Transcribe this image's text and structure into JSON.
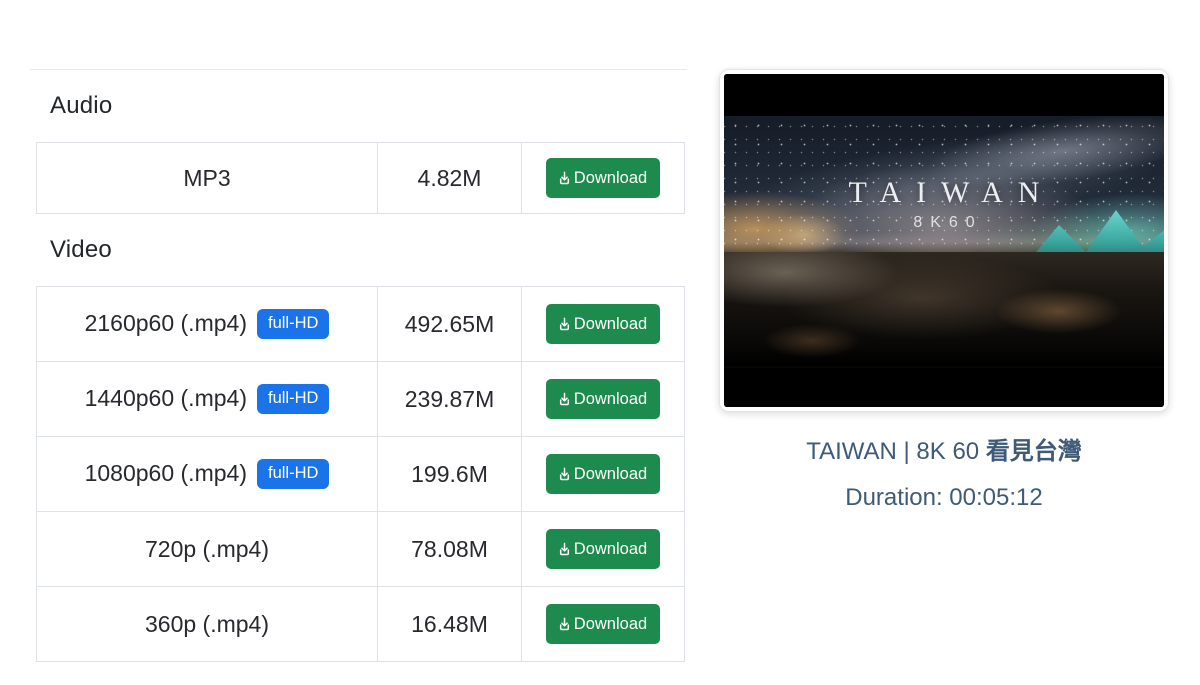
{
  "colors": {
    "download_button_green": "#1e8b4e",
    "badge_blue": "#1a73e8",
    "info_text_blue": "#3e5a78",
    "table_border": "#dee2e6"
  },
  "sections": {
    "audio": {
      "heading": "Audio",
      "rows": [
        {
          "format": "MP3",
          "size": "4.82M",
          "download_label": "Download"
        }
      ]
    },
    "video": {
      "heading": "Video",
      "rows": [
        {
          "format": "2160p60 (.mp4)",
          "badge": "full-HD",
          "size": "492.65M",
          "download_label": "Download"
        },
        {
          "format": "1440p60 (.mp4)",
          "badge": "full-HD",
          "size": "239.87M",
          "download_label": "Download"
        },
        {
          "format": "1080p60 (.mp4)",
          "badge": "full-HD",
          "size": "199.6M",
          "download_label": "Download"
        },
        {
          "format": "720p (.mp4)",
          "size": "78.08M",
          "download_label": "Download"
        },
        {
          "format": "360p (.mp4)",
          "size": "16.48M",
          "download_label": "Download"
        }
      ]
    }
  },
  "video_info": {
    "thumbnail_overlay": {
      "title": "TAIWAN",
      "subtitle": "8K60"
    },
    "title_latin": "TAIWAN | 8K 60 ",
    "title_cjk": "看見台灣",
    "duration": "Duration: 00:05:12"
  }
}
